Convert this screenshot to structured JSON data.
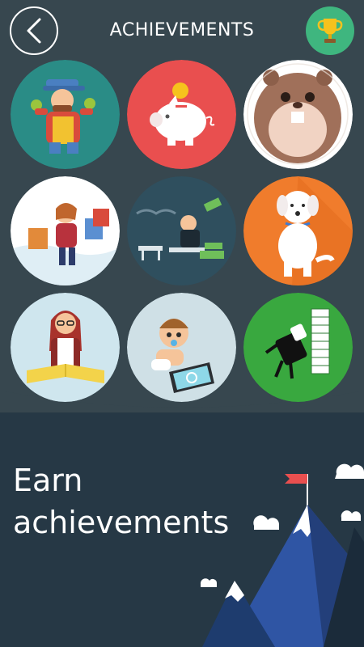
{
  "header": {
    "title": "ACHIEVEMENTS",
    "back_icon": "chevron-left-icon",
    "trophy_icon": "trophy-icon"
  },
  "achievements": [
    {
      "name": "farmer",
      "color": "#2a8c86"
    },
    {
      "name": "piggy-bank",
      "color": "#e94f4f"
    },
    {
      "name": "hamster",
      "color": "#ffffff"
    },
    {
      "name": "shopping",
      "color": "#ffffff"
    },
    {
      "name": "money-relax",
      "color": "#2f4f5e"
    },
    {
      "name": "dog",
      "color": "#f07c2c"
    },
    {
      "name": "reader",
      "color": "#cfe6ee"
    },
    {
      "name": "baby-tablet",
      "color": "#cfe0e6"
    },
    {
      "name": "brick-wall",
      "color": "#39a83f"
    }
  ],
  "promo": {
    "headline_line1": "Earn",
    "headline_line2": "achievements"
  },
  "colors": {
    "background": "#263845",
    "panel": "#37474f",
    "accent_green": "#3fb67f"
  }
}
